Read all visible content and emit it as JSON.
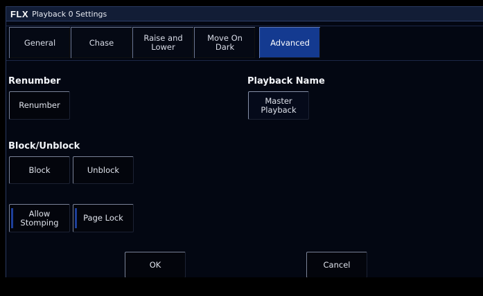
{
  "titlebar": {
    "brand": "FLX",
    "title": "Playback 0 Settings"
  },
  "tabs": [
    {
      "label": "General",
      "active": false
    },
    {
      "label": "Chase",
      "active": false
    },
    {
      "label": "Raise and\nLower",
      "active": false
    },
    {
      "label": "Move On\nDark",
      "active": false
    },
    {
      "label": "Advanced",
      "active": true
    }
  ],
  "renumber": {
    "section_label": "Renumber",
    "button_label": "Renumber"
  },
  "playback_name": {
    "section_label": "Playback Name",
    "button_label": "Master\nPlayback"
  },
  "block": {
    "section_label": "Block/Unblock",
    "block_label": "Block",
    "unblock_label": "Unblock"
  },
  "toggles": {
    "allow_stomping_label": "Allow\nStomping",
    "page_lock_label": "Page Lock"
  },
  "footer": {
    "ok_label": "OK",
    "cancel_label": "Cancel"
  },
  "colors": {
    "active_tab": "#143a90",
    "indicator": "#1d3f9a",
    "background": "#030712"
  }
}
